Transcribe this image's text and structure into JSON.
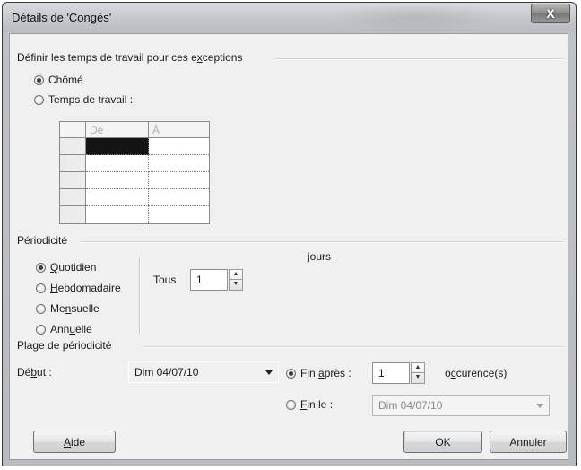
{
  "window": {
    "title": "Détails de 'Congés'",
    "close_glyph": "X"
  },
  "work_times": {
    "group_label_pre": "Définir les temps de travail pour ces e",
    "group_label_mn": "x",
    "group_label_post": "ceptions",
    "options": [
      {
        "label": "Chômé",
        "selected": true
      },
      {
        "label": "Temps de travail :",
        "selected": false
      }
    ],
    "grid": {
      "headers": [
        "De",
        "À"
      ],
      "rows": 5
    }
  },
  "recurrence": {
    "group_label": "Périodicité",
    "options": [
      {
        "mn": "Q",
        "rest": "uotidien",
        "selected": true
      },
      {
        "mn": "H",
        "rest": "ebdomadaire",
        "selected": false
      },
      {
        "pre": "Me",
        "mn": "n",
        "rest": "suelle",
        "selected": false
      },
      {
        "pre": "Ann",
        "mn": "u",
        "rest": "elle",
        "selected": false
      }
    ],
    "every_label": "Tous",
    "every_value": "1",
    "unit_label": "jours"
  },
  "range": {
    "group_label": "Plage de périodicité",
    "start_pre": "Dé",
    "start_mn": "b",
    "start_post": "ut :",
    "start_value": "Dim 04/07/10",
    "end_after": {
      "label_pre": "Fin ",
      "label_mn": "a",
      "label_post": "près :",
      "selected": true,
      "value": "1",
      "unit_pre": "o",
      "unit_mn": "c",
      "unit_post": "curence(s)"
    },
    "end_by": {
      "label_mn": "F",
      "label_post": "in le :",
      "selected": false,
      "value": "Dim 04/07/10"
    }
  },
  "buttons": {
    "help_mn": "A",
    "help_rest": "ide",
    "ok": "OK",
    "cancel": "Annuler"
  }
}
